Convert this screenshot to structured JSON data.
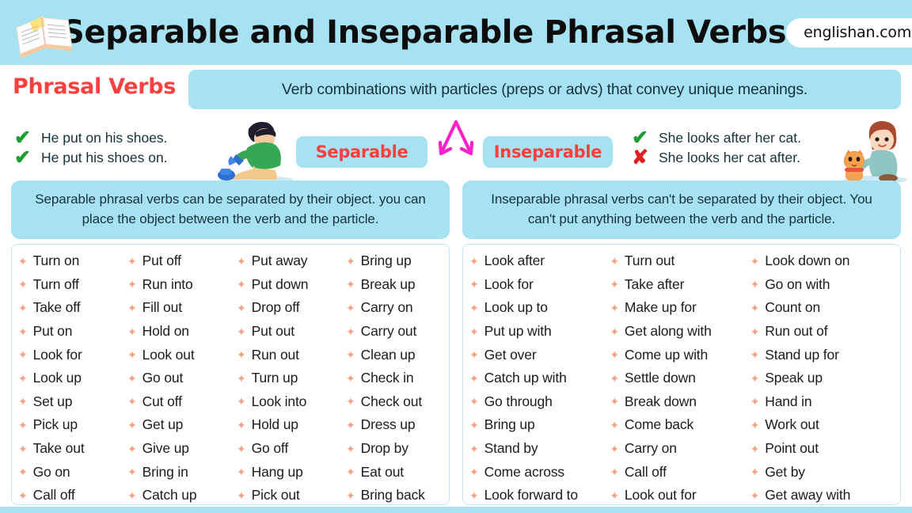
{
  "header": {
    "title": "Separable and Inseparable Phrasal Verbs",
    "brand": "englishan.com",
    "search_icon": "search-icon",
    "book_icon": "open-book-icon",
    "bg_color": "#a6e2f2"
  },
  "intro": {
    "label": "Phrasal Verbs",
    "label_color": "#fa3f3f",
    "definition": "Verb combinations with particles (preps or advs) that convey unique meanings."
  },
  "examples": {
    "left": {
      "marks": [
        "✔",
        "✔"
      ],
      "mark_types": [
        "ok",
        "ok"
      ],
      "lines": [
        "He put on his shoes.",
        "He put his shoes on."
      ],
      "illustration": "boy-putting-on-shoes-illustration"
    },
    "right": {
      "marks": [
        "✔",
        "✘"
      ],
      "mark_types": [
        "ok",
        "bad"
      ],
      "lines": [
        "She looks after her cat.",
        "She looks her cat after."
      ],
      "illustration": "girl-with-cat-illustration"
    },
    "chip_left": "Separable",
    "chip_right": "Inseparable",
    "arrow_icon": "split-double-arrow-icon",
    "arrow_color": "#ff22c8"
  },
  "descriptions": {
    "left": "Separable phrasal verbs can be separated by their object. you can place the object between the verb and the particle.",
    "right": "Inseparable phrasal verbs can't be separated by their object. You can't put anything between the verb and the particle."
  },
  "separable_columns": [
    [
      "Turn on",
      "Turn off",
      "Take off",
      "Put on",
      "Look for",
      "Look up",
      "Set up",
      "Pick up",
      "Take out",
      "Go on",
      "Call off"
    ],
    [
      "Put off",
      "Run into",
      "Fill out",
      "Hold on",
      "Look out",
      "Go out",
      "Cut off",
      "Get up",
      "Give up",
      "Bring in",
      "Catch up"
    ],
    [
      "Put away",
      "Put down",
      "Drop off",
      "Put out",
      "Run out",
      "Turn up",
      "Look into",
      "Hold up",
      "Go off",
      "Hang up",
      "Pick out"
    ],
    [
      "Bring up",
      "Break up",
      "Carry on",
      "Carry out",
      "Clean up",
      "Check in",
      "Check out",
      "Dress up",
      "Drop by",
      "Eat out",
      "Bring back"
    ]
  ],
  "inseparable_columns": [
    [
      "Look after",
      "Look for",
      "Look up to",
      "Put up with",
      "Get over",
      "Catch up with",
      "Go through",
      "Bring up",
      "Stand by",
      "Come across",
      "Look forward to"
    ],
    [
      "Turn out",
      "Take after",
      "Make up for",
      "Get along with",
      "Come up with",
      "Settle down",
      "Break down",
      "Come back",
      "Carry on",
      "Call off",
      "Look out for"
    ],
    [
      "Look down on",
      "Go on with",
      "Count on",
      "Run out of",
      "Stand up for",
      "Speak up",
      "Hand in",
      "Work out",
      "Point out",
      "Get by",
      "Get away with"
    ]
  ],
  "colors": {
    "accent_cyan": "#a6e2f2",
    "accent_red": "#fa3f3f",
    "bullet_peach": "#f6a182",
    "check_green": "#1f9d35",
    "cross_red": "#e02020",
    "panel_border": "#bfe7f4"
  },
  "bullet_glyph": "✦"
}
